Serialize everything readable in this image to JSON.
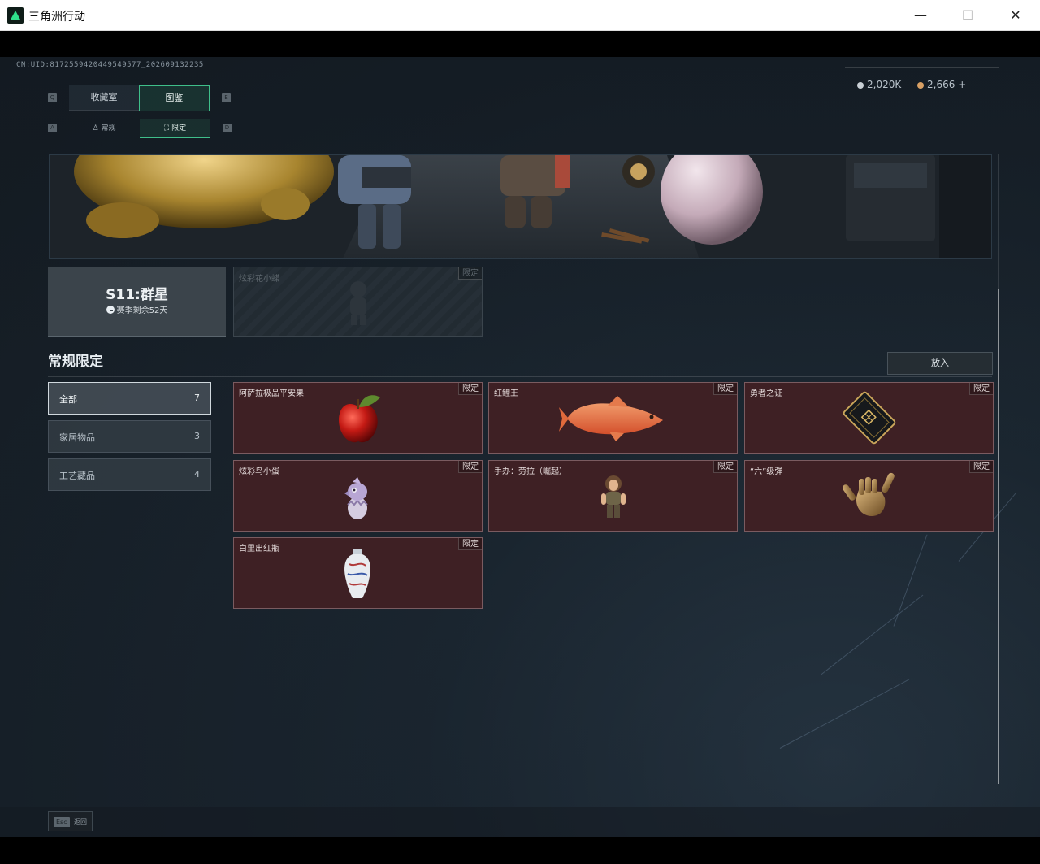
{
  "window": {
    "title": "三角洲行动",
    "minimize": "—",
    "maximize": "☐",
    "close": "✕"
  },
  "header": {
    "uid": "CN:UID:8172559420449549577_202609132235",
    "currency_1": "2,020K",
    "currency_2": "2,666",
    "currency_add": "+",
    "colors": {
      "accent": "#3fbf8a",
      "item_bg": "#3e2024"
    }
  },
  "tabs_primary": {
    "key_left": "Q",
    "key_right": "E",
    "items": [
      "收藏室",
      "图鉴"
    ],
    "selected": "图鉴"
  },
  "tabs_secondary": {
    "key_left": "A",
    "key_right": "D",
    "items": [
      "常规",
      "限定"
    ],
    "selected": "限定"
  },
  "season": {
    "name": "S11:群星",
    "remaining": "赛季剩余52天"
  },
  "locked_item": {
    "name": "炫彩花小蝶",
    "badge": "限定"
  },
  "section": {
    "title": "常规限定",
    "put_button": "放入"
  },
  "categories": [
    {
      "label": "全部",
      "count": "7",
      "selected": true
    },
    {
      "label": "家居物品",
      "count": "3",
      "selected": false
    },
    {
      "label": "工艺藏品",
      "count": "4",
      "selected": false
    }
  ],
  "items": [
    {
      "name": "阿萨拉极品平安果",
      "badge": "限定",
      "icon": "apple-icon"
    },
    {
      "name": "红鲤王",
      "badge": "限定",
      "icon": "carp-icon"
    },
    {
      "name": "勇者之证",
      "badge": "限定",
      "icon": "card-icon"
    },
    {
      "name": "炫彩鸟小蛋",
      "badge": "限定",
      "icon": "egg-icon"
    },
    {
      "name": "手办：劳拉（崛起）",
      "badge": "限定",
      "icon": "figure-icon"
    },
    {
      "name": "“六”级弹",
      "badge": "限定",
      "icon": "hand-icon"
    },
    {
      "name": "白里出红瓶",
      "badge": "限定",
      "icon": "vase-icon"
    }
  ],
  "footer": {
    "esc_key": "Esc",
    "esc_label": "返回"
  }
}
